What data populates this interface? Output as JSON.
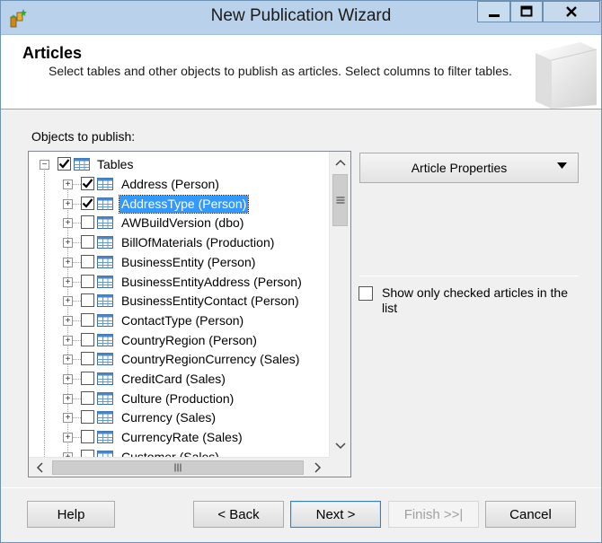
{
  "window": {
    "title": "New Publication Wizard",
    "controls": {
      "minimize": "minimize-icon",
      "maximize": "maximize-icon",
      "close": "close-icon"
    }
  },
  "header": {
    "title": "Articles",
    "description": "Select tables and other objects to publish as articles. Select columns to filter tables."
  },
  "objects": {
    "label": "Objects to publish:",
    "root": {
      "label": "Tables",
      "checked": true,
      "expanded": true
    },
    "items": [
      {
        "label": "Address (Person)",
        "checked": true,
        "selected": false
      },
      {
        "label": "AddressType (Person)",
        "checked": true,
        "selected": true
      },
      {
        "label": "AWBuildVersion (dbo)",
        "checked": false,
        "selected": false
      },
      {
        "label": "BillOfMaterials (Production)",
        "checked": false,
        "selected": false
      },
      {
        "label": "BusinessEntity (Person)",
        "checked": false,
        "selected": false
      },
      {
        "label": "BusinessEntityAddress (Person)",
        "checked": false,
        "selected": false
      },
      {
        "label": "BusinessEntityContact (Person)",
        "checked": false,
        "selected": false
      },
      {
        "label": "ContactType (Person)",
        "checked": false,
        "selected": false
      },
      {
        "label": "CountryRegion (Person)",
        "checked": false,
        "selected": false
      },
      {
        "label": "CountryRegionCurrency (Sales)",
        "checked": false,
        "selected": false
      },
      {
        "label": "CreditCard (Sales)",
        "checked": false,
        "selected": false
      },
      {
        "label": "Culture (Production)",
        "checked": false,
        "selected": false
      },
      {
        "label": "Currency (Sales)",
        "checked": false,
        "selected": false
      },
      {
        "label": "CurrencyRate (Sales)",
        "checked": false,
        "selected": false
      },
      {
        "label": "Customer (Sales)",
        "checked": false,
        "selected": false
      }
    ]
  },
  "right_panel": {
    "article_properties_label": "Article Properties",
    "show_only_checked_label": "Show only checked articles in the list",
    "show_only_checked": false
  },
  "footer": {
    "help_label": "Help",
    "back_label": "< Back",
    "next_label": "Next >",
    "finish_label": "Finish >>|",
    "cancel_label": "Cancel"
  },
  "colors": {
    "title_bar": "#b9d1ea",
    "selection": "#3399ff",
    "dialog_bg": "#f0f0f0"
  }
}
